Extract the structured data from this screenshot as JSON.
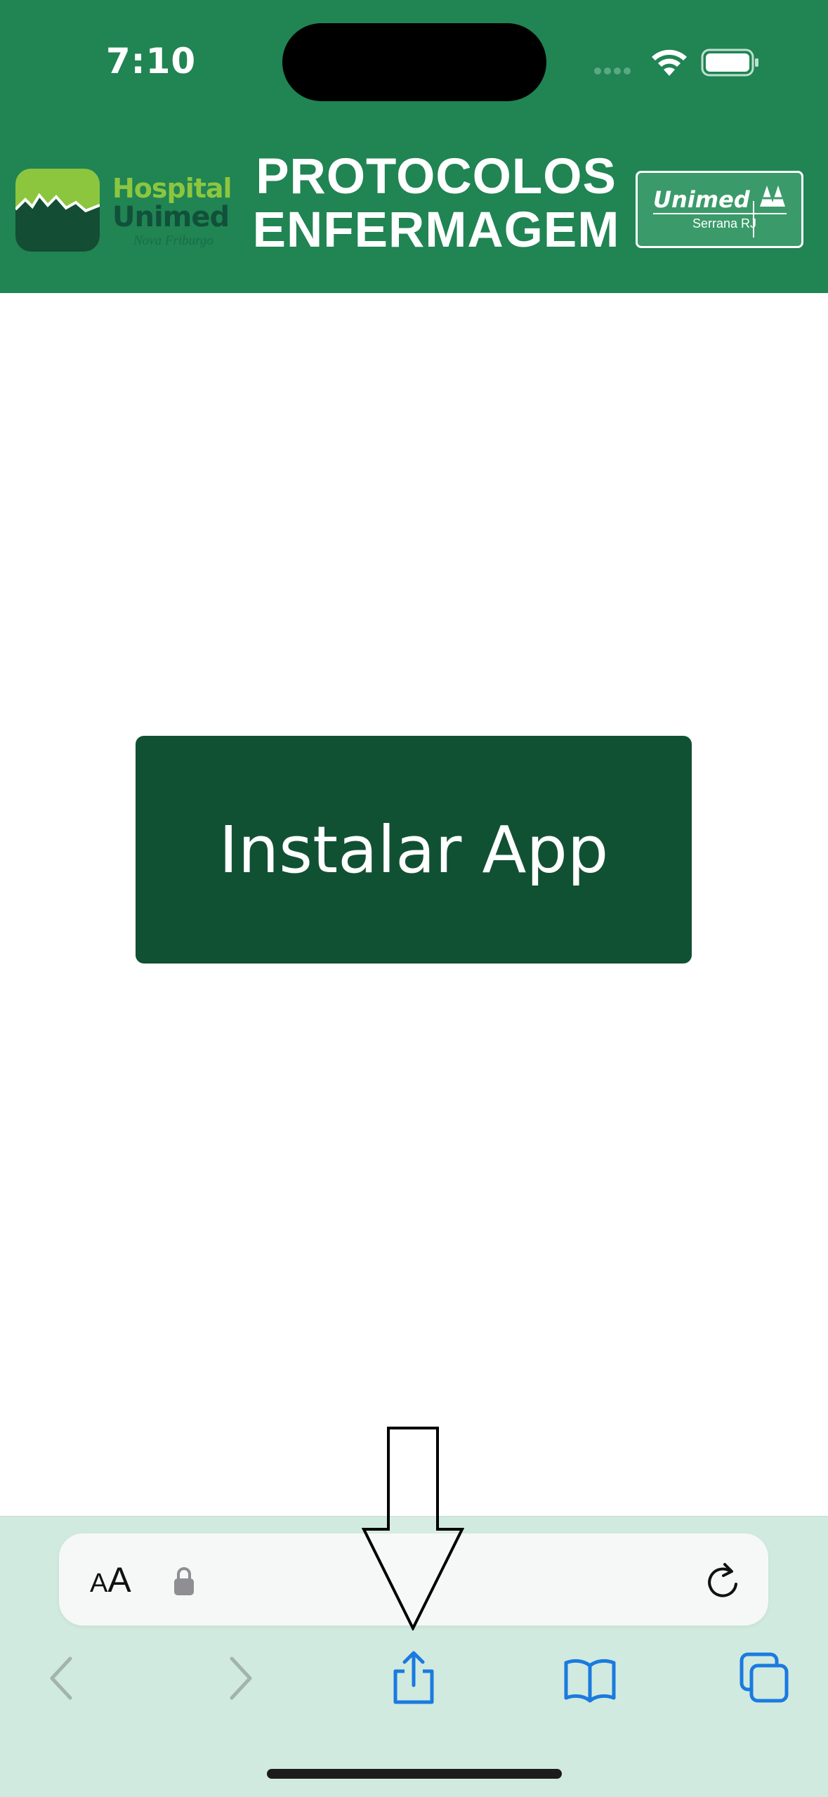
{
  "status_bar": {
    "time": "7:10"
  },
  "header": {
    "title_line1": "PROTOCOLOS",
    "title_line2": "ENFERMAGEM",
    "left_logo": {
      "line1": "Hospital",
      "line2": "Unimed",
      "line3": "Nova Friburgo"
    },
    "right_logo": {
      "name": "Unimed",
      "sub": "Serrana RJ"
    }
  },
  "main": {
    "install_button_label": "Instalar App"
  },
  "browser": {
    "text_size_label_small": "A",
    "text_size_label_big": "A",
    "toolbar_icons": [
      "back-icon",
      "forward-icon",
      "share-icon",
      "bookmarks-icon",
      "tabs-icon"
    ]
  },
  "colors": {
    "header_bg": "#208453",
    "button_bg": "#115133",
    "toolbar_bg": "#d0eadf",
    "toolbar_accent": "#1a7ae0"
  }
}
